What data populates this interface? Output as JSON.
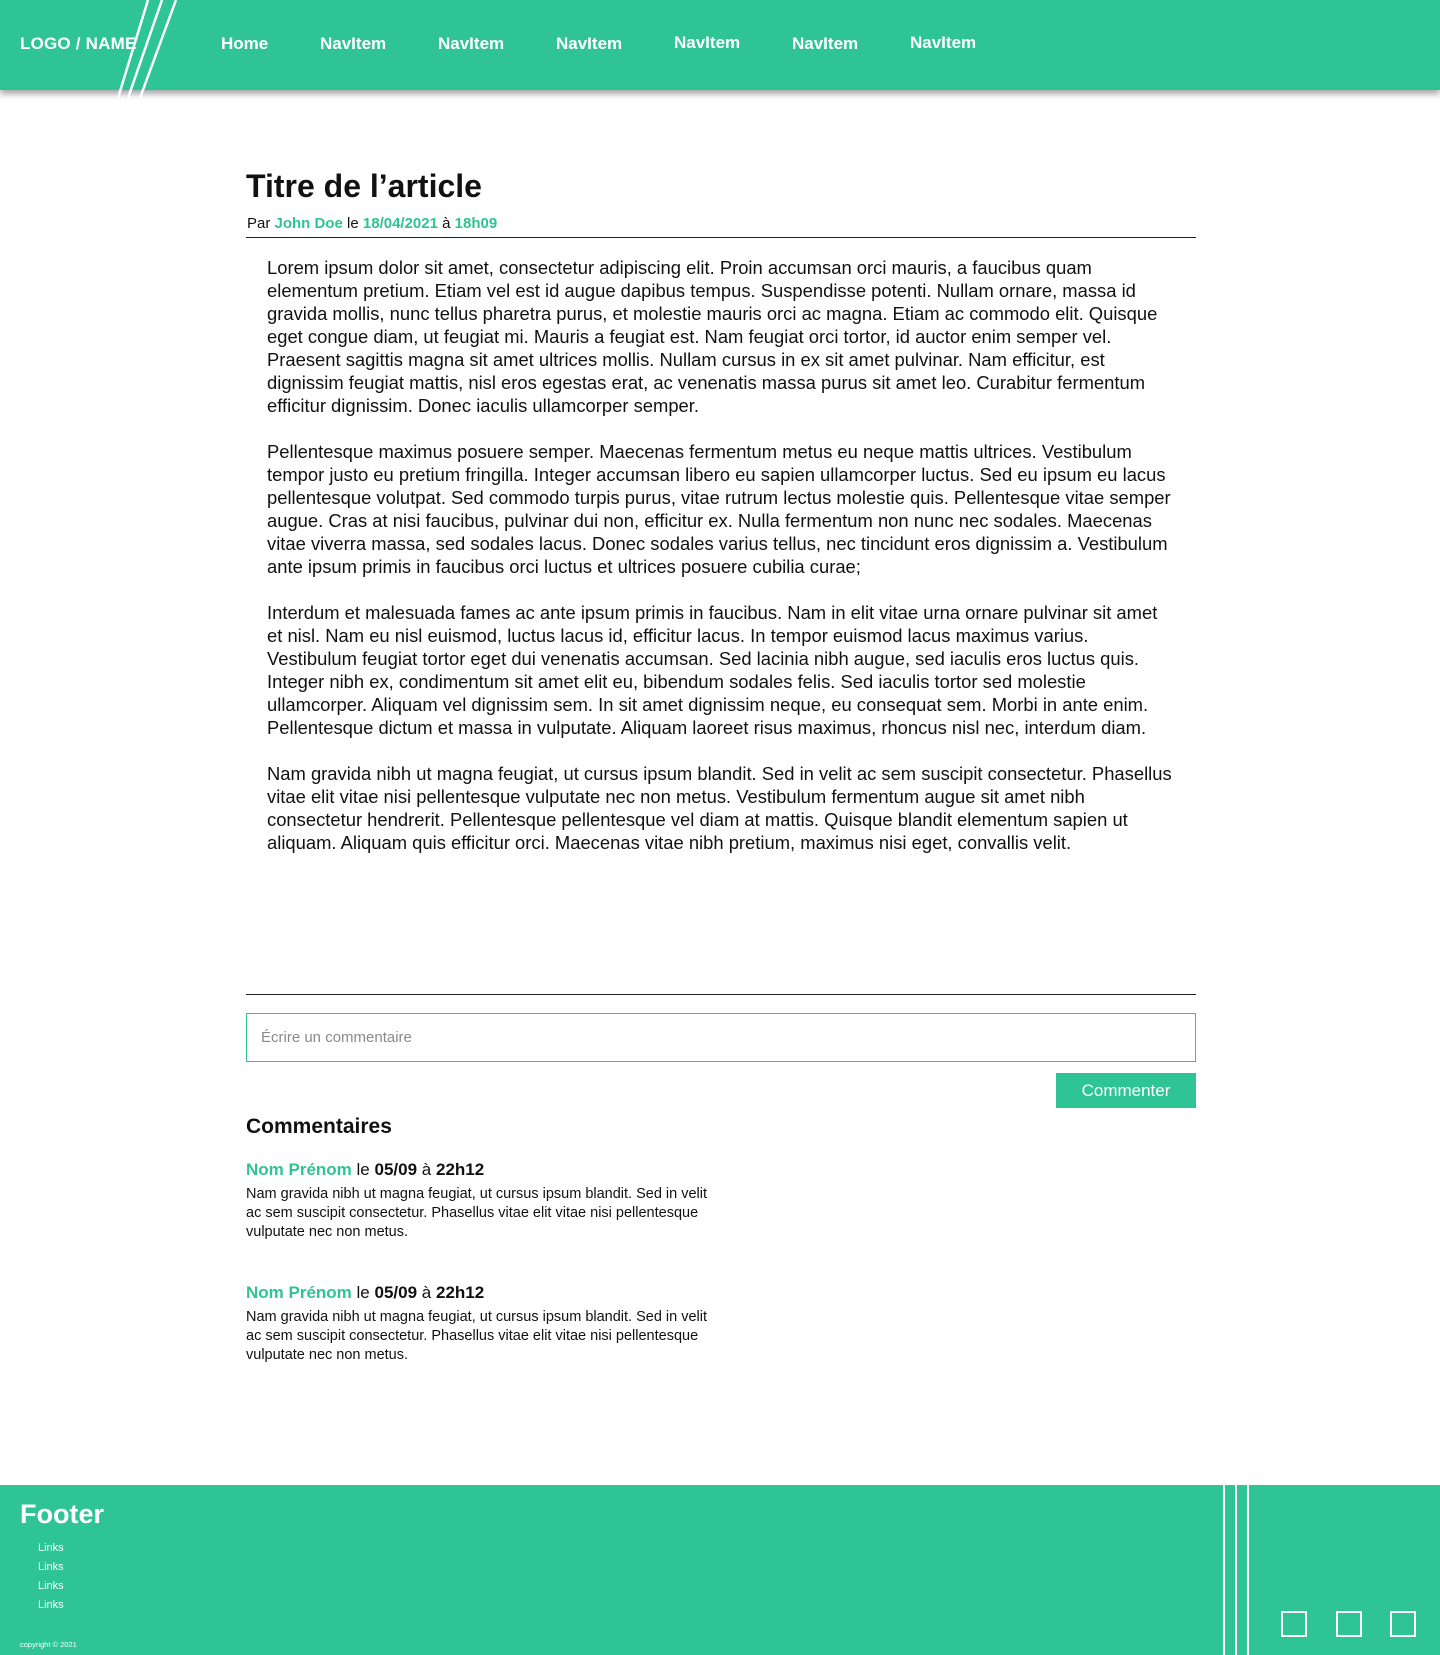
{
  "header": {
    "logo": "LOGO / NAME",
    "nav": [
      "Home",
      "NavItem",
      "NavItem",
      "NavItem",
      "NavItem",
      "NavItem",
      "NavItem"
    ]
  },
  "article": {
    "title": "Titre de l’article",
    "meta": {
      "by_label": "Par",
      "author": "John Doe",
      "on_label": "le",
      "date": "18/04/2021",
      "at_label": "à",
      "time": "18h09"
    },
    "paragraphs": [
      "Lorem ipsum dolor sit amet, consectetur adipiscing elit. Proin accumsan orci mauris, a faucibus quam elementum pretium. Etiam vel est id augue dapibus tempus. Suspendisse potenti. Nullam ornare, massa id gravida mollis, nunc tellus pharetra purus, et molestie mauris orci ac magna. Etiam ac commodo elit. Quisque eget congue diam, ut feugiat mi. Mauris a feugiat est. Nam feugiat orci tortor, id auctor enim semper vel. Praesent sagittis magna sit amet ultrices mollis. Nullam cursus in ex sit amet pulvinar. Nam efficitur, est dignissim feugiat mattis, nisl eros egestas erat, ac venenatis massa purus sit amet leo. Curabitur fermentum efficitur dignissim. Donec iaculis ullamcorper semper.",
      "Pellentesque maximus posuere semper. Maecenas fermentum metus eu neque mattis ultrices. Vestibulum tempor justo eu pretium fringilla. Integer accumsan libero eu sapien ullamcorper luctus. Sed eu ipsum eu lacus pellentesque volutpat. Sed commodo turpis purus, vitae rutrum lectus molestie quis. Pellentesque vitae semper augue. Cras at nisi faucibus, pulvinar dui non, efficitur ex. Nulla fermentum non nunc nec sodales. Maecenas vitae viverra massa, sed sodales lacus. Donec sodales varius tellus, nec tincidunt eros dignissim a. Vestibulum ante ipsum primis in faucibus orci luctus et ultrices posuere cubilia curae;",
      "Interdum et malesuada fames ac ante ipsum primis in faucibus. Nam in elit vitae urna ornare pulvinar sit amet et nisl. Nam eu nisl euismod, luctus lacus id, efficitur lacus. In tempor euismod lacus maximus varius. Vestibulum feugiat tortor eget dui venenatis accumsan. Sed lacinia nibh augue, sed iaculis eros luctus quis. Integer nibh ex, condimentum sit amet elit eu, bibendum sodales felis. Sed iaculis tortor sed molestie ullamcorper. Aliquam vel dignissim sem. In sit amet dignissim neque, eu consequat sem. Morbi in ante enim. Pellentesque dictum et massa in vulputate. Aliquam laoreet risus maximus, rhoncus nisl nec, interdum diam.",
      "Nam gravida nibh ut magna feugiat, ut cursus ipsum blandit. Sed in velit ac sem suscipit consectetur. Phasellus vitae elit vitae nisi pellentesque vulputate nec non metus. Vestibulum fermentum augue sit amet nibh consectetur hendrerit. Pellentesque pellentesque vel diam at mattis. Quisque blandit elementum sapien ut aliquam. Aliquam quis efficitur orci. Maecenas vitae nibh pretium, maximus nisi eget, convallis velit."
    ]
  },
  "comment_form": {
    "placeholder": "Écrire un commentaire",
    "value": "",
    "submit_label": "Commenter"
  },
  "comments": {
    "heading": "Commentaires",
    "items": [
      {
        "author": "Nom Prénom",
        "on_label": "le",
        "date": "05/09",
        "at_label": "à",
        "time": "22h12",
        "text": "Nam gravida nibh ut magna feugiat, ut cursus ipsum blandit. Sed in velit ac sem suscipit consectetur. Phasellus vitae elit vitae nisi pellentesque vulputate nec non metus."
      },
      {
        "author": "Nom Prénom",
        "on_label": "le",
        "date": "05/09",
        "at_label": "à",
        "time": "22h12",
        "text": "Nam gravida nibh ut magna feugiat, ut cursus ipsum blandit. Sed in velit ac sem suscipit consectetur. Phasellus vitae elit vitae nisi pellentesque vulputate nec non metus."
      }
    ]
  },
  "footer": {
    "title": "Footer",
    "links": [
      "Links",
      "Links",
      "Links",
      "Links"
    ],
    "copyright": "copyright © 2021",
    "social_icons": [
      "social-square-icon",
      "social-square-icon",
      "social-square-icon"
    ]
  },
  "colors": {
    "accent": "#2ec493",
    "text": "#111111",
    "background": "#ffffff"
  }
}
